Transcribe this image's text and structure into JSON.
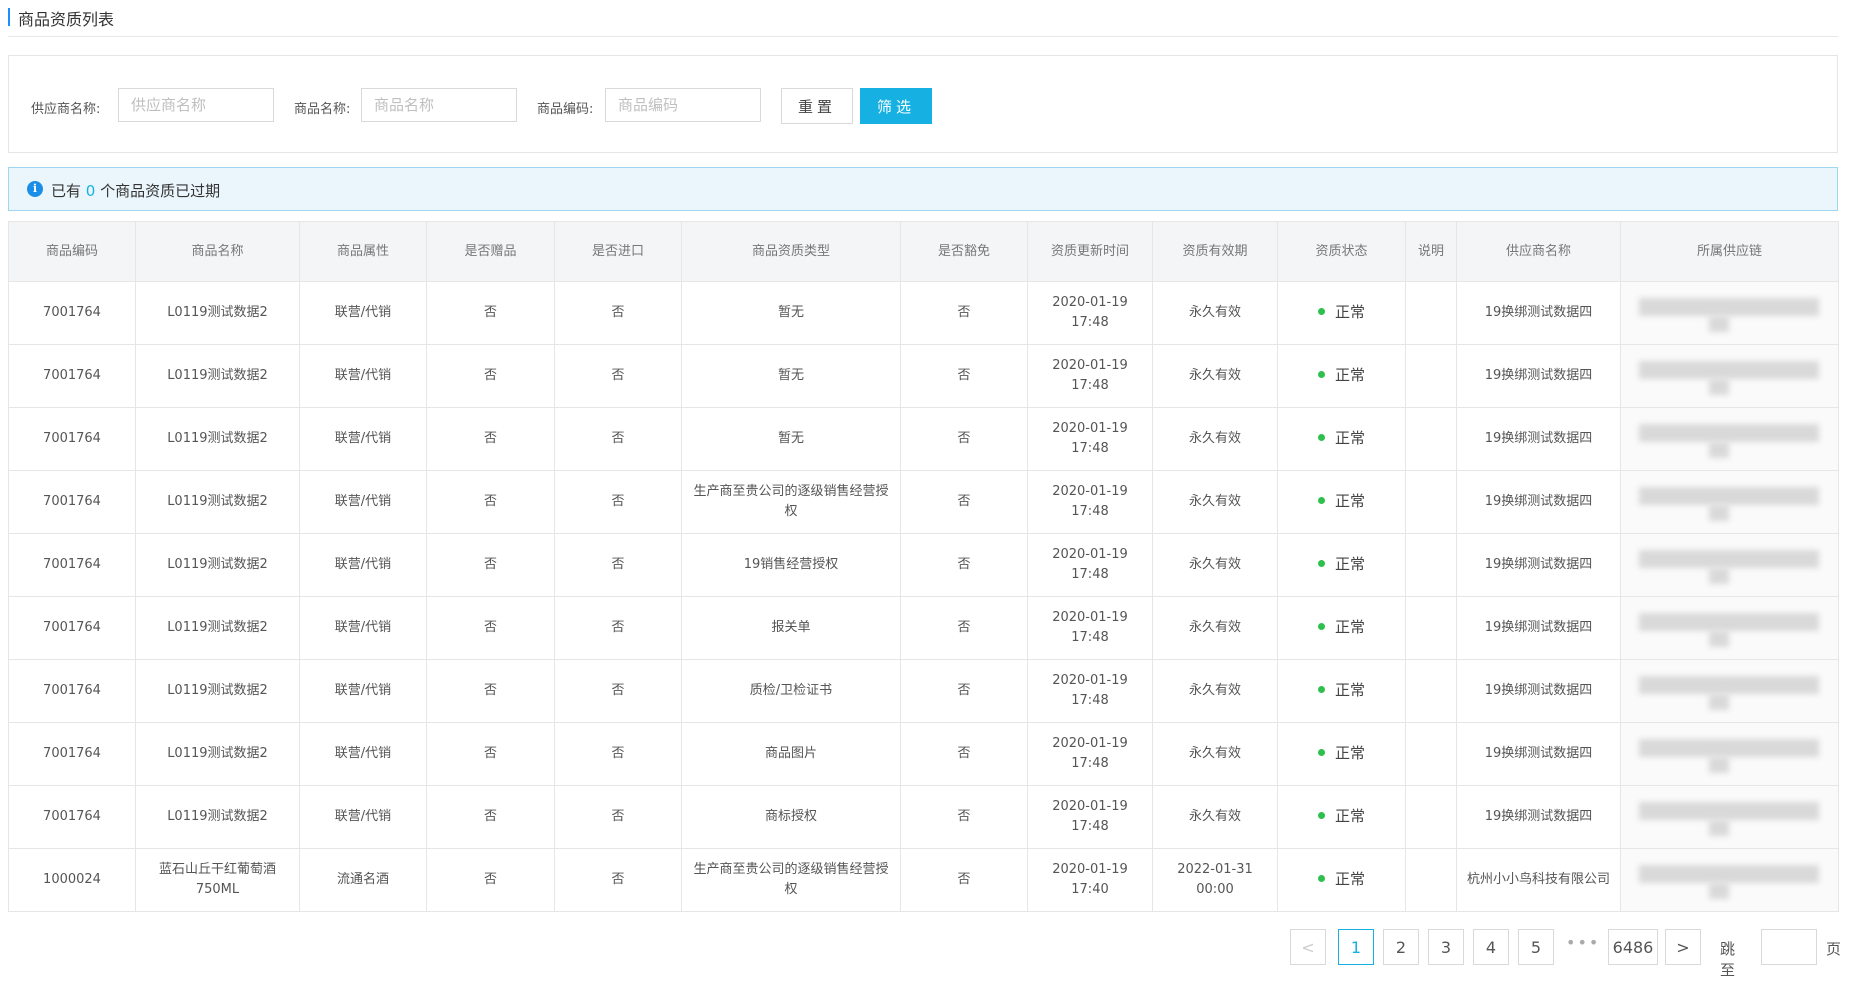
{
  "header": {
    "title": "商品资质列表"
  },
  "filters": {
    "supplier_label": "供应商名称:",
    "supplier_placeholder": "供应商名称",
    "product_label": "商品名称:",
    "product_placeholder": "商品名称",
    "code_label": "商品编码:",
    "code_placeholder": "商品编码",
    "reset_label": "重置",
    "filter_label": "筛选"
  },
  "alert": {
    "prefix": "已有",
    "count": "0",
    "suffix": "个商品资质已过期"
  },
  "colors": {
    "accent": "#16b1e2",
    "status_ok": "#2fbf4e",
    "info": "#1b8fe8"
  },
  "table": {
    "headers": [
      "商品编码",
      "商品名称",
      "商品属性",
      "是否赠品",
      "是否进口",
      "商品资质类型",
      "是否豁免",
      "资质更新时间",
      "资质有效期",
      "资质状态",
      "说明",
      "供应商名称",
      "所属供应链"
    ],
    "rows": [
      {
        "code": "7001764",
        "name": "L0119测试数据2",
        "attr": "联营/代销",
        "gift": "否",
        "import": "否",
        "type": "暂无",
        "exempt": "否",
        "updated": "2020-01-19 17:48",
        "validity": "永久有效",
        "status": "正常",
        "note": "",
        "supplier": "19换绑测试数据四",
        "chain": ""
      },
      {
        "code": "7001764",
        "name": "L0119测试数据2",
        "attr": "联营/代销",
        "gift": "否",
        "import": "否",
        "type": "暂无",
        "exempt": "否",
        "updated": "2020-01-19 17:48",
        "validity": "永久有效",
        "status": "正常",
        "note": "",
        "supplier": "19换绑测试数据四",
        "chain": ""
      },
      {
        "code": "7001764",
        "name": "L0119测试数据2",
        "attr": "联营/代销",
        "gift": "否",
        "import": "否",
        "type": "暂无",
        "exempt": "否",
        "updated": "2020-01-19 17:48",
        "validity": "永久有效",
        "status": "正常",
        "note": "",
        "supplier": "19换绑测试数据四",
        "chain": ""
      },
      {
        "code": "7001764",
        "name": "L0119测试数据2",
        "attr": "联营/代销",
        "gift": "否",
        "import": "否",
        "type": "生产商至贵公司的逐级销售经营授权",
        "exempt": "否",
        "updated": "2020-01-19 17:48",
        "validity": "永久有效",
        "status": "正常",
        "note": "",
        "supplier": "19换绑测试数据四",
        "chain": ""
      },
      {
        "code": "7001764",
        "name": "L0119测试数据2",
        "attr": "联营/代销",
        "gift": "否",
        "import": "否",
        "type": "19销售经营授权",
        "exempt": "否",
        "updated": "2020-01-19 17:48",
        "validity": "永久有效",
        "status": "正常",
        "note": "",
        "supplier": "19换绑测试数据四",
        "chain": ""
      },
      {
        "code": "7001764",
        "name": "L0119测试数据2",
        "attr": "联营/代销",
        "gift": "否",
        "import": "否",
        "type": "报关单",
        "exempt": "否",
        "updated": "2020-01-19 17:48",
        "validity": "永久有效",
        "status": "正常",
        "note": "",
        "supplier": "19换绑测试数据四",
        "chain": ""
      },
      {
        "code": "7001764",
        "name": "L0119测试数据2",
        "attr": "联营/代销",
        "gift": "否",
        "import": "否",
        "type": "质检/卫检证书",
        "exempt": "否",
        "updated": "2020-01-19 17:48",
        "validity": "永久有效",
        "status": "正常",
        "note": "",
        "supplier": "19换绑测试数据四",
        "chain": ""
      },
      {
        "code": "7001764",
        "name": "L0119测试数据2",
        "attr": "联营/代销",
        "gift": "否",
        "import": "否",
        "type": "商品图片",
        "exempt": "否",
        "updated": "2020-01-19 17:48",
        "validity": "永久有效",
        "status": "正常",
        "note": "",
        "supplier": "19换绑测试数据四",
        "chain": ""
      },
      {
        "code": "7001764",
        "name": "L0119测试数据2",
        "attr": "联营/代销",
        "gift": "否",
        "import": "否",
        "type": "商标授权",
        "exempt": "否",
        "updated": "2020-01-19 17:48",
        "validity": "永久有效",
        "status": "正常",
        "note": "",
        "supplier": "19换绑测试数据四",
        "chain": ""
      },
      {
        "code": "1000024",
        "name": "蓝石山丘干红葡萄酒750ML",
        "attr": "流通名酒",
        "gift": "否",
        "import": "否",
        "type": "生产商至贵公司的逐级销售经营授权",
        "exempt": "否",
        "updated": "2020-01-19 17:40",
        "validity": "2022-01-31 00:00",
        "status": "正常",
        "note": "",
        "supplier": "杭州小小鸟科技有限公司",
        "chain": ""
      }
    ]
  },
  "pagination": {
    "prev": "<",
    "pages": [
      "1",
      "2",
      "3",
      "4",
      "5"
    ],
    "ellipsis": "•••",
    "last": "6486",
    "next": ">",
    "current": "1",
    "jump_label": "跳至",
    "page_suffix": "页"
  }
}
